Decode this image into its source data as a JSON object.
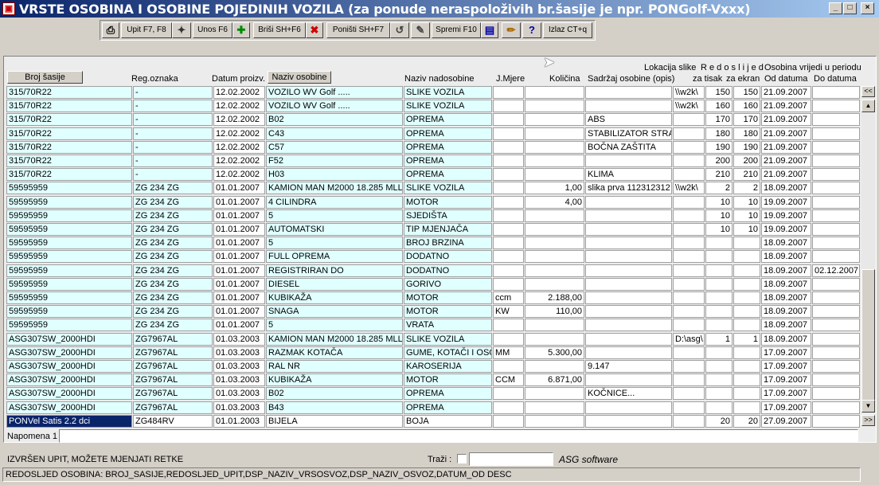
{
  "window": {
    "title": "VRSTE OSOBINA I OSOBINE POJEDINIH VOZILA (za ponude neraspoloživih br.šasije je npr. PONGolf-Vxxx)",
    "minimize": "_",
    "maximize": "□",
    "close": "×"
  },
  "toolbar": {
    "print_icon": "printer-icon",
    "query_label": "Upit F7, F8",
    "query_icon": "wand-icon",
    "insert_label": "Unos F6",
    "insert_icon": "plus-icon",
    "delete_label": "Briši SH+F6",
    "delete_icon": "x-icon",
    "undo_label": "Poništi SH+F7",
    "undo_icon": "undo-icon",
    "edit_icon": "notepad-icon",
    "save_label": "Spremi F10",
    "save_icon": "floppy-icon",
    "pencil_icon": "pencil-icon",
    "help_icon": "question-icon",
    "exit_label": "Izlaz CT+q"
  },
  "headers": {
    "broj_sasije": "Broj šasije",
    "reg_oznaka": "Reg.oznaka",
    "datum_proizv": "Datum proizv.",
    "naziv_osobine": "Naziv osobine",
    "naziv_nadosobine": "Naziv nadosobine",
    "j_mjere": "J.Mjere",
    "kolicina": "Količina",
    "sadrzaj": "Sadržaj osobine (opis)",
    "lokacija_1": "Lokacija slike",
    "lokacija_2": "za tisak",
    "redoslijed_1": "R e d o s l i j e d",
    "redoslijed_2": "za ekran",
    "period_1": "Osobina vrijedi u periodu",
    "od_datuma": "Od datuma",
    "do_datuma": "Do datuma"
  },
  "rows": [
    [
      "315/70R22",
      "-",
      "12.02.2002",
      "VOZILO WV Golf .....",
      "SLIKE VOZILA",
      "",
      "",
      "",
      "\\\\w2k\\",
      "150",
      "150",
      "21.09.2007",
      ""
    ],
    [
      "315/70R22",
      "-",
      "12.02.2002",
      "VOZILO WV Golf .....",
      "SLIKE VOZILA",
      "",
      "",
      "",
      "\\\\w2k\\",
      "160",
      "160",
      "21.09.2007",
      ""
    ],
    [
      "315/70R22",
      "-",
      "12.02.2002",
      "B02",
      "OPREMA",
      "",
      "",
      "ABS",
      "",
      "170",
      "170",
      "21.09.2007",
      ""
    ],
    [
      "315/70R22",
      "-",
      "12.02.2002",
      "C43",
      "OPREMA",
      "",
      "",
      "STABILIZATOR STRA",
      "",
      "180",
      "180",
      "21.09.2007",
      ""
    ],
    [
      "315/70R22",
      "-",
      "12.02.2002",
      "C57",
      "OPREMA",
      "",
      "",
      "BOČNA ZAŠTITA",
      "",
      "190",
      "190",
      "21.09.2007",
      ""
    ],
    [
      "315/70R22",
      "-",
      "12.02.2002",
      "F52",
      "OPREMA",
      "",
      "",
      "",
      "",
      "200",
      "200",
      "21.09.2007",
      ""
    ],
    [
      "315/70R22",
      "-",
      "12.02.2002",
      "H03",
      "OPREMA",
      "",
      "",
      "KLIMA",
      "",
      "210",
      "210",
      "21.09.2007",
      ""
    ],
    [
      "59595959",
      "ZG 234 ZG",
      "01.01.2007",
      "KAMION MAN M2000 18.285 MLL(",
      "SLIKE VOZILA",
      "",
      "1,00",
      "slika prva 112312312",
      "\\\\w2k\\",
      "2",
      "2",
      "18.09.2007",
      ""
    ],
    [
      "59595959",
      "ZG 234 ZG",
      "01.01.2007",
      "4 CILINDRA",
      "MOTOR",
      "",
      "4,00",
      "",
      "",
      "10",
      "10",
      "19.09.2007",
      ""
    ],
    [
      "59595959",
      "ZG 234 ZG",
      "01.01.2007",
      "5",
      "SJEDIŠTA",
      "",
      "",
      "",
      "",
      "10",
      "10",
      "19.09.2007",
      ""
    ],
    [
      "59595959",
      "ZG 234 ZG",
      "01.01.2007",
      "AUTOMATSKI",
      "TIP MJENJAČA",
      "",
      "",
      "",
      "",
      "10",
      "10",
      "19.09.2007",
      ""
    ],
    [
      "59595959",
      "ZG 234 ZG",
      "01.01.2007",
      "5",
      "BROJ BRZINA",
      "",
      "",
      "",
      "",
      "",
      "",
      "18.09.2007",
      ""
    ],
    [
      "59595959",
      "ZG 234 ZG",
      "01.01.2007",
      "FULL OPREMA",
      "DODATNO",
      "",
      "",
      "",
      "",
      "",
      "",
      "18.09.2007",
      ""
    ],
    [
      "59595959",
      "ZG 234 ZG",
      "01.01.2007",
      "REGISTRIRAN DO",
      "DODATNO",
      "",
      "",
      "",
      "",
      "",
      "",
      "18.09.2007",
      "02.12.2007"
    ],
    [
      "59595959",
      "ZG 234 ZG",
      "01.01.2007",
      "DIESEL",
      "GORIVO",
      "",
      "",
      "",
      "",
      "",
      "",
      "18.09.2007",
      ""
    ],
    [
      "59595959",
      "ZG 234 ZG",
      "01.01.2007",
      "KUBIKAŽA",
      "MOTOR",
      "ccm",
      "2.188,00",
      "",
      "",
      "",
      "",
      "18.09.2007",
      ""
    ],
    [
      "59595959",
      "ZG 234 ZG",
      "01.01.2007",
      "SNAGA",
      "MOTOR",
      "KW",
      "110,00",
      "",
      "",
      "",
      "",
      "18.09.2007",
      ""
    ],
    [
      "59595959",
      "ZG 234 ZG",
      "01.01.2007",
      "5",
      "VRATA",
      "",
      "",
      "",
      "",
      "",
      "",
      "18.09.2007",
      ""
    ],
    [
      "ASG307SW_2000HDI",
      "ZG7967AL",
      "01.03.2003",
      "KAMION MAN M2000 18.285 MLL(",
      "SLIKE VOZILA",
      "",
      "",
      "",
      "D:\\asg\\",
      "1",
      "1",
      "18.09.2007",
      ""
    ],
    [
      "ASG307SW_2000HDI",
      "ZG7967AL",
      "01.03.2003",
      "RAZMAK KOTAČA",
      "GUME, KOTAČI I OSO",
      "MM",
      "5.300,00",
      "",
      "",
      "",
      "",
      "17.09.2007",
      ""
    ],
    [
      "ASG307SW_2000HDI",
      "ZG7967AL",
      "01.03.2003",
      "RAL NR",
      "KAROSERIJA",
      "",
      "",
      "9.147",
      "",
      "",
      "",
      "17.09.2007",
      ""
    ],
    [
      "ASG307SW_2000HDI",
      "ZG7967AL",
      "01.03.2003",
      "KUBIKAŽA",
      "MOTOR",
      "CCM",
      "6.871,00",
      "",
      "",
      "",
      "",
      "17.09.2007",
      ""
    ],
    [
      "ASG307SW_2000HDI",
      "ZG7967AL",
      "01.03.2003",
      "B02",
      "OPREMA",
      "",
      "",
      "KOČNICE...",
      "",
      "",
      "",
      "17.09.2007",
      ""
    ],
    [
      "ASG307SW_2000HDI",
      "ZG7967AL",
      "01.03.2003",
      "B43",
      "OPREMA",
      "",
      "",
      "",
      "",
      "",
      "",
      "17.09.2007",
      ""
    ],
    [
      "PONVel Satis 2.2 dci",
      "ZG484RV",
      "01.01.2003",
      "BIJELA",
      "BOJA",
      "",
      "",
      "",
      "",
      "20",
      "20",
      "27.09.2007",
      ""
    ]
  ],
  "scroll": {
    "up": "▲",
    "down": "▼",
    "left_page": "<<",
    "right_page": ">>"
  },
  "napomena": {
    "label": "Napomena 1",
    "value": ""
  },
  "status": {
    "message": "IZVRŠEN UPIT, MOŽETE MJENJATI RETKE",
    "search_label": "Traži :",
    "brand": "ASG software",
    "order_line": "REDOSLJED OSOBINA: BROJ_SASIJE,REDOSLJED_UPIT,DSP_NAZIV_VRSOSVOZ,DSP_NAZIV_OSVOZ,DATUM_OD DESC"
  }
}
